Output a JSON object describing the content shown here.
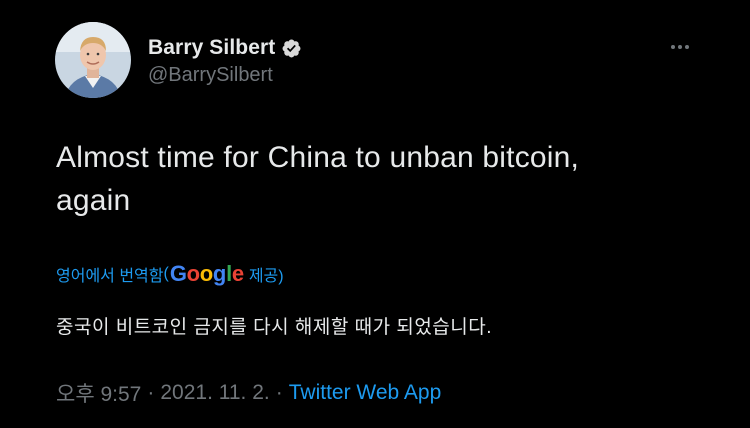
{
  "author": {
    "display_name": "Barry Silbert",
    "handle": "@BarrySilbert",
    "verified": true,
    "avatar_icon": "profile-photo"
  },
  "more_icon": "more-horizontal-icon",
  "tweet": {
    "text_line1": "Almost time for China to unban bitcoin,",
    "text_line2": "again"
  },
  "translation": {
    "label_prefix": "영어에서 번역함",
    "brand": "Google",
    "brand_letters": [
      "G",
      "o",
      "o",
      "g",
      "l",
      "e"
    ],
    "label_suffix": "제공)",
    "translated_text": "중국이 비트코인 금지를 다시 해제할 때가 되었습니다."
  },
  "meta": {
    "time": "오후 9:57",
    "separator": "·",
    "date": "2021. 11. 2.",
    "source": "Twitter Web App"
  },
  "colors": {
    "background": "#000000",
    "primary_text": "#e7e9ea",
    "secondary_text": "#71767b",
    "link": "#1d9bf0",
    "verified_badge": "#d9d9d9"
  }
}
